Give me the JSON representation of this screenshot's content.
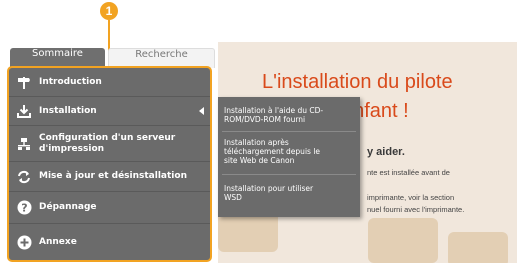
{
  "callout": {
    "number": "1"
  },
  "tabs": [
    {
      "label": "Sommaire",
      "active": true
    },
    {
      "label": "Recherche",
      "active": false
    }
  ],
  "sidebar": {
    "items": [
      {
        "label": "Introduction",
        "icon": "signpost-icon"
      },
      {
        "label": "Installation",
        "icon": "download-icon",
        "has_submenu": true
      },
      {
        "label_line1": "Configuration d'un serveur",
        "label_line2": "d'impression",
        "icon": "network-icon"
      },
      {
        "label": "Mise à jour et désinstallation",
        "icon": "refresh-icon"
      },
      {
        "label": "Dépannage",
        "icon": "question-icon"
      },
      {
        "label": "Annexe",
        "icon": "plus-icon"
      }
    ]
  },
  "submenu": {
    "items": [
      {
        "line1": "Installation à l'aide du CD-",
        "line2": "ROM/DVD-ROM fourni"
      },
      {
        "line1": "Installation après",
        "line2": "téléchargement depuis le",
        "line3": "site Web de Canon"
      },
      {
        "line1": "Installation pour utiliser",
        "line2": "WSD"
      }
    ]
  },
  "preview": {
    "headline_line1": "L'installation du pilote",
    "headline_line2": "enfant !",
    "aide": "y aider.",
    "p1": "nte est installée avant de",
    "p2_line1": "imprimante, voir la section",
    "p2_line2": "nuel fourni avec l'imprimante."
  },
  "colors": {
    "accent": "#f2a322",
    "sidebar_bg": "#6b6b6b",
    "headline": "#d94a1b"
  }
}
